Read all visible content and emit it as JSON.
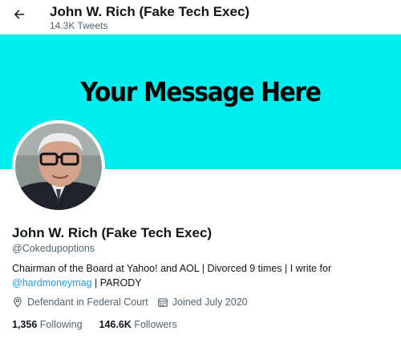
{
  "header": {
    "title": "John W. Rich (Fake Tech Exec)",
    "tweet_count": "14.3K Tweets"
  },
  "banner": {
    "text": "Your Message Here",
    "color": "#00eef0"
  },
  "profile": {
    "name": "John W. Rich (Fake Tech Exec)",
    "handle": "@Cokedupoptions",
    "bio_text": "Chairman of the Board at Yahoo! and AOL  | Divorced 9 times | I write for",
    "bio_link": "@hardmoneymag",
    "bio_suffix": " | PARODY",
    "location": "Defendant in Federal Court",
    "joined": "Joined July 2020",
    "following_count": "1,356",
    "following_label": " Following",
    "followers_count": "146.6K",
    "followers_label": " Followers"
  },
  "icons": [
    "back-arrow-icon",
    "location-pin-icon",
    "calendar-icon"
  ],
  "colors": {
    "link": "#1d9bf0",
    "secondary_text": "#536471"
  }
}
